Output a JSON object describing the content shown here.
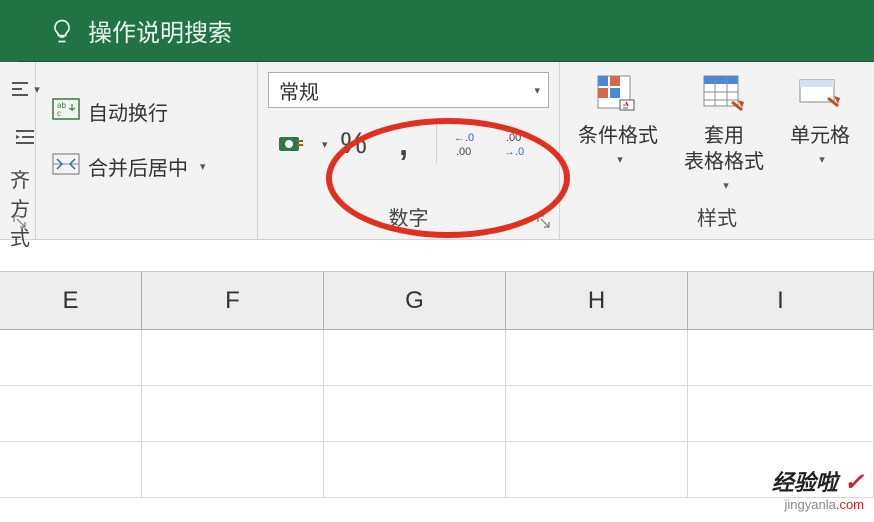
{
  "title": {
    "search_text": "操作说明搜索"
  },
  "alignment": {
    "group_label": "齐方式",
    "wrap_text": "自动换行",
    "merge_center": "合并后居中"
  },
  "number": {
    "group_label": "数字",
    "format_selected": "常规",
    "percent": "%",
    "comma": ","
  },
  "styles": {
    "group_label": "样式",
    "conditional": "条件格式",
    "table_format_line1": "套用",
    "table_format_line2": "表格格式",
    "cell_styles": "单元格"
  },
  "columns": [
    "E",
    "F",
    "G",
    "H",
    "I"
  ],
  "watermark": {
    "top_text": "经验啦",
    "bottom_prefix": "jingyanla",
    "bottom_suffix": ".com"
  }
}
